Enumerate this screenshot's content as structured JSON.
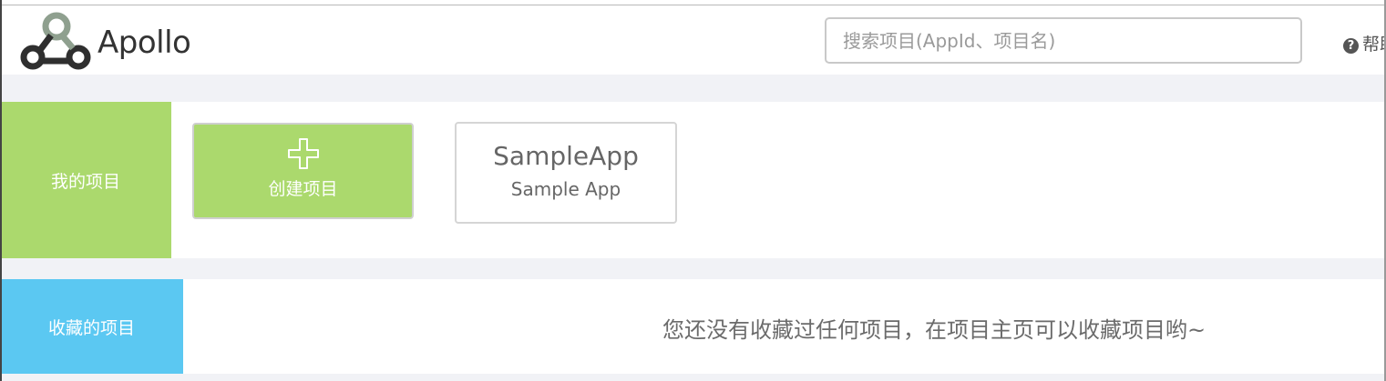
{
  "brand": {
    "name": "Apollo"
  },
  "header": {
    "search_placeholder": "搜索项目(AppId、项目名)",
    "help_label": "帮助"
  },
  "my_projects": {
    "label": "我的项目",
    "create_label": "创建项目",
    "apps": [
      {
        "app_id": "SampleApp",
        "name": "Sample App"
      }
    ]
  },
  "favorites": {
    "label": "收藏的项目",
    "empty_message": "您还没有收藏过任何项目，在项目主页可以收藏项目哟~"
  },
  "colors": {
    "my_projects_accent": "#abd96d",
    "favorites_accent": "#5bc8f2"
  }
}
